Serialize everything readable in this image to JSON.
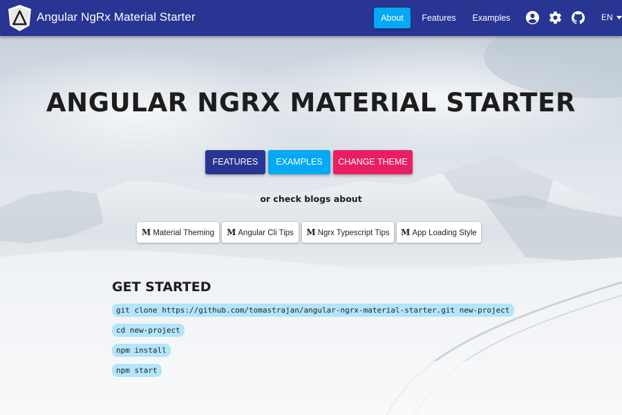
{
  "toolbar": {
    "title": "Angular NgRx Material Starter",
    "nav": {
      "about": "About",
      "features": "Features",
      "examples": "Examples"
    },
    "icons": [
      "account-icon",
      "settings-icon",
      "github-icon"
    ],
    "language": "EN",
    "colors": {
      "primary": "#283593",
      "accent": "#03a9f4"
    }
  },
  "hero": {
    "title": "ANGULAR NGRX MATERIAL STARTER",
    "buttons": {
      "features": "FEATURES",
      "examples": "EXAMPLES",
      "change_theme": "CHANGE THEME"
    },
    "button_colors": {
      "features": "#283593",
      "examples": "#03a9f4",
      "change_theme": "#e91e63"
    },
    "blogs_intro": "or check blogs about",
    "blogs": [
      {
        "icon": "M",
        "label": "Material Theming"
      },
      {
        "icon": "M",
        "label": "Angular Cli Tips"
      },
      {
        "icon": "M",
        "label": "Ngrx Typescript Tips"
      },
      {
        "icon": "M",
        "label": "App Loading Style"
      }
    ]
  },
  "get_started": {
    "title": "GET STARTED",
    "commands": [
      "git clone https://github.com/tomastrajan/angular-ngrx-material-starter.git new-project",
      "cd new-project",
      "npm install",
      "npm start"
    ]
  }
}
